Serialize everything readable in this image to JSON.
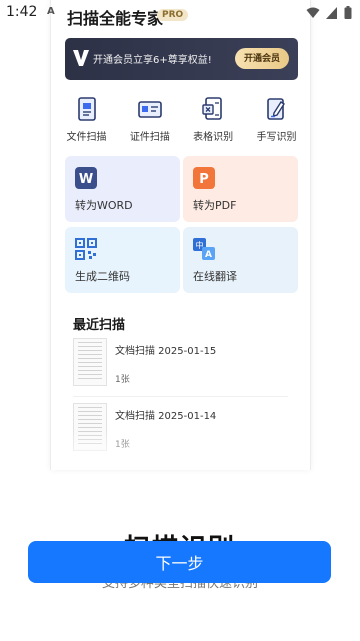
{
  "status_bar": {
    "time": "1:42",
    "indicator": "A",
    "icons": [
      "wifi-icon",
      "signal-icon",
      "battery-icon"
    ]
  },
  "preview": {
    "app_title": "扫描全能专家",
    "pro_badge": "PRO",
    "vip_banner": {
      "text": "开通会员立享6+尊享权益!",
      "button": "开通会员"
    },
    "quick_actions": [
      {
        "label": "文件扫描",
        "icon": "document-scan-icon"
      },
      {
        "label": "证件扫描",
        "icon": "id-card-icon"
      },
      {
        "label": "表格识别",
        "icon": "table-icon"
      },
      {
        "label": "手写识别",
        "icon": "handwriting-icon"
      }
    ],
    "tiles": [
      {
        "label": "转为WORD",
        "icon": "word-icon",
        "icon_letter": "W"
      },
      {
        "label": "转为PDF",
        "icon": "pdf-icon",
        "icon_letter": "P"
      },
      {
        "label": "生成二维码",
        "icon": "qrcode-icon"
      },
      {
        "label": "在线翻译",
        "icon": "translate-icon",
        "icon_letters": [
          "中",
          "A"
        ]
      }
    ],
    "recent_title": "最近扫描",
    "recent_items": [
      {
        "name": "文档扫描  2025-01-15",
        "count": "1张"
      },
      {
        "name": "文档扫描  2025-01-14",
        "count": "1张"
      }
    ]
  },
  "feature": {
    "title": "扫描识别",
    "subtitle": "支持多种类型扫描快速识别"
  },
  "next_button": "下一步",
  "colors": {
    "primary": "#1677ff",
    "vip_bg": "#2d3146",
    "vip_gold": "#e9c986",
    "word_tile": "#eaeefc",
    "pdf_tile": "#fdebe4"
  }
}
